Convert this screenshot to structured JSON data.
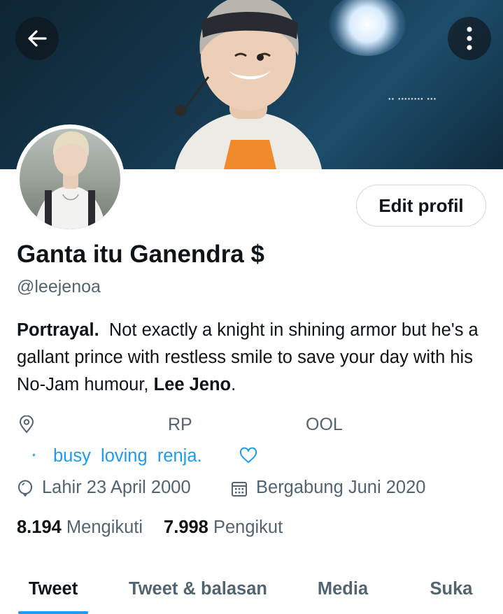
{
  "profile": {
    "display_name": "Ganta itu Ganendra $",
    "handle": "@leejenoa",
    "bio": {
      "prefix": "Portrayal",
      "dot": ".",
      "text": "  Not exactly a knight in shining armor but he's a gallant prince with restless smile to save your day with his No-Jam humour, ",
      "bold_name": "Lee Jeno",
      "suffix": "."
    },
    "location": {
      "part1": "RP",
      "part2": "OOL"
    },
    "website": {
      "star": "⋆",
      "text": "busy  loving  renja."
    },
    "birth": "Lahir 23 April 2000",
    "joined": "Bergabung Juni 2020"
  },
  "stats": {
    "following_count": "8.194",
    "following_label": "Mengikuti",
    "followers_count": "7.998",
    "followers_label": "Pengikut"
  },
  "buttons": {
    "edit_profile": "Edit profil"
  },
  "tabs": [
    {
      "label": "Tweet",
      "active": true
    },
    {
      "label": "Tweet & balasan",
      "active": false
    },
    {
      "label": "Media",
      "active": false
    },
    {
      "label": "Suka",
      "active": false
    }
  ],
  "colors": {
    "accent": "#1d9bf0",
    "text_primary": "#0f1419",
    "text_secondary": "#536471",
    "border": "#cfd9de"
  }
}
